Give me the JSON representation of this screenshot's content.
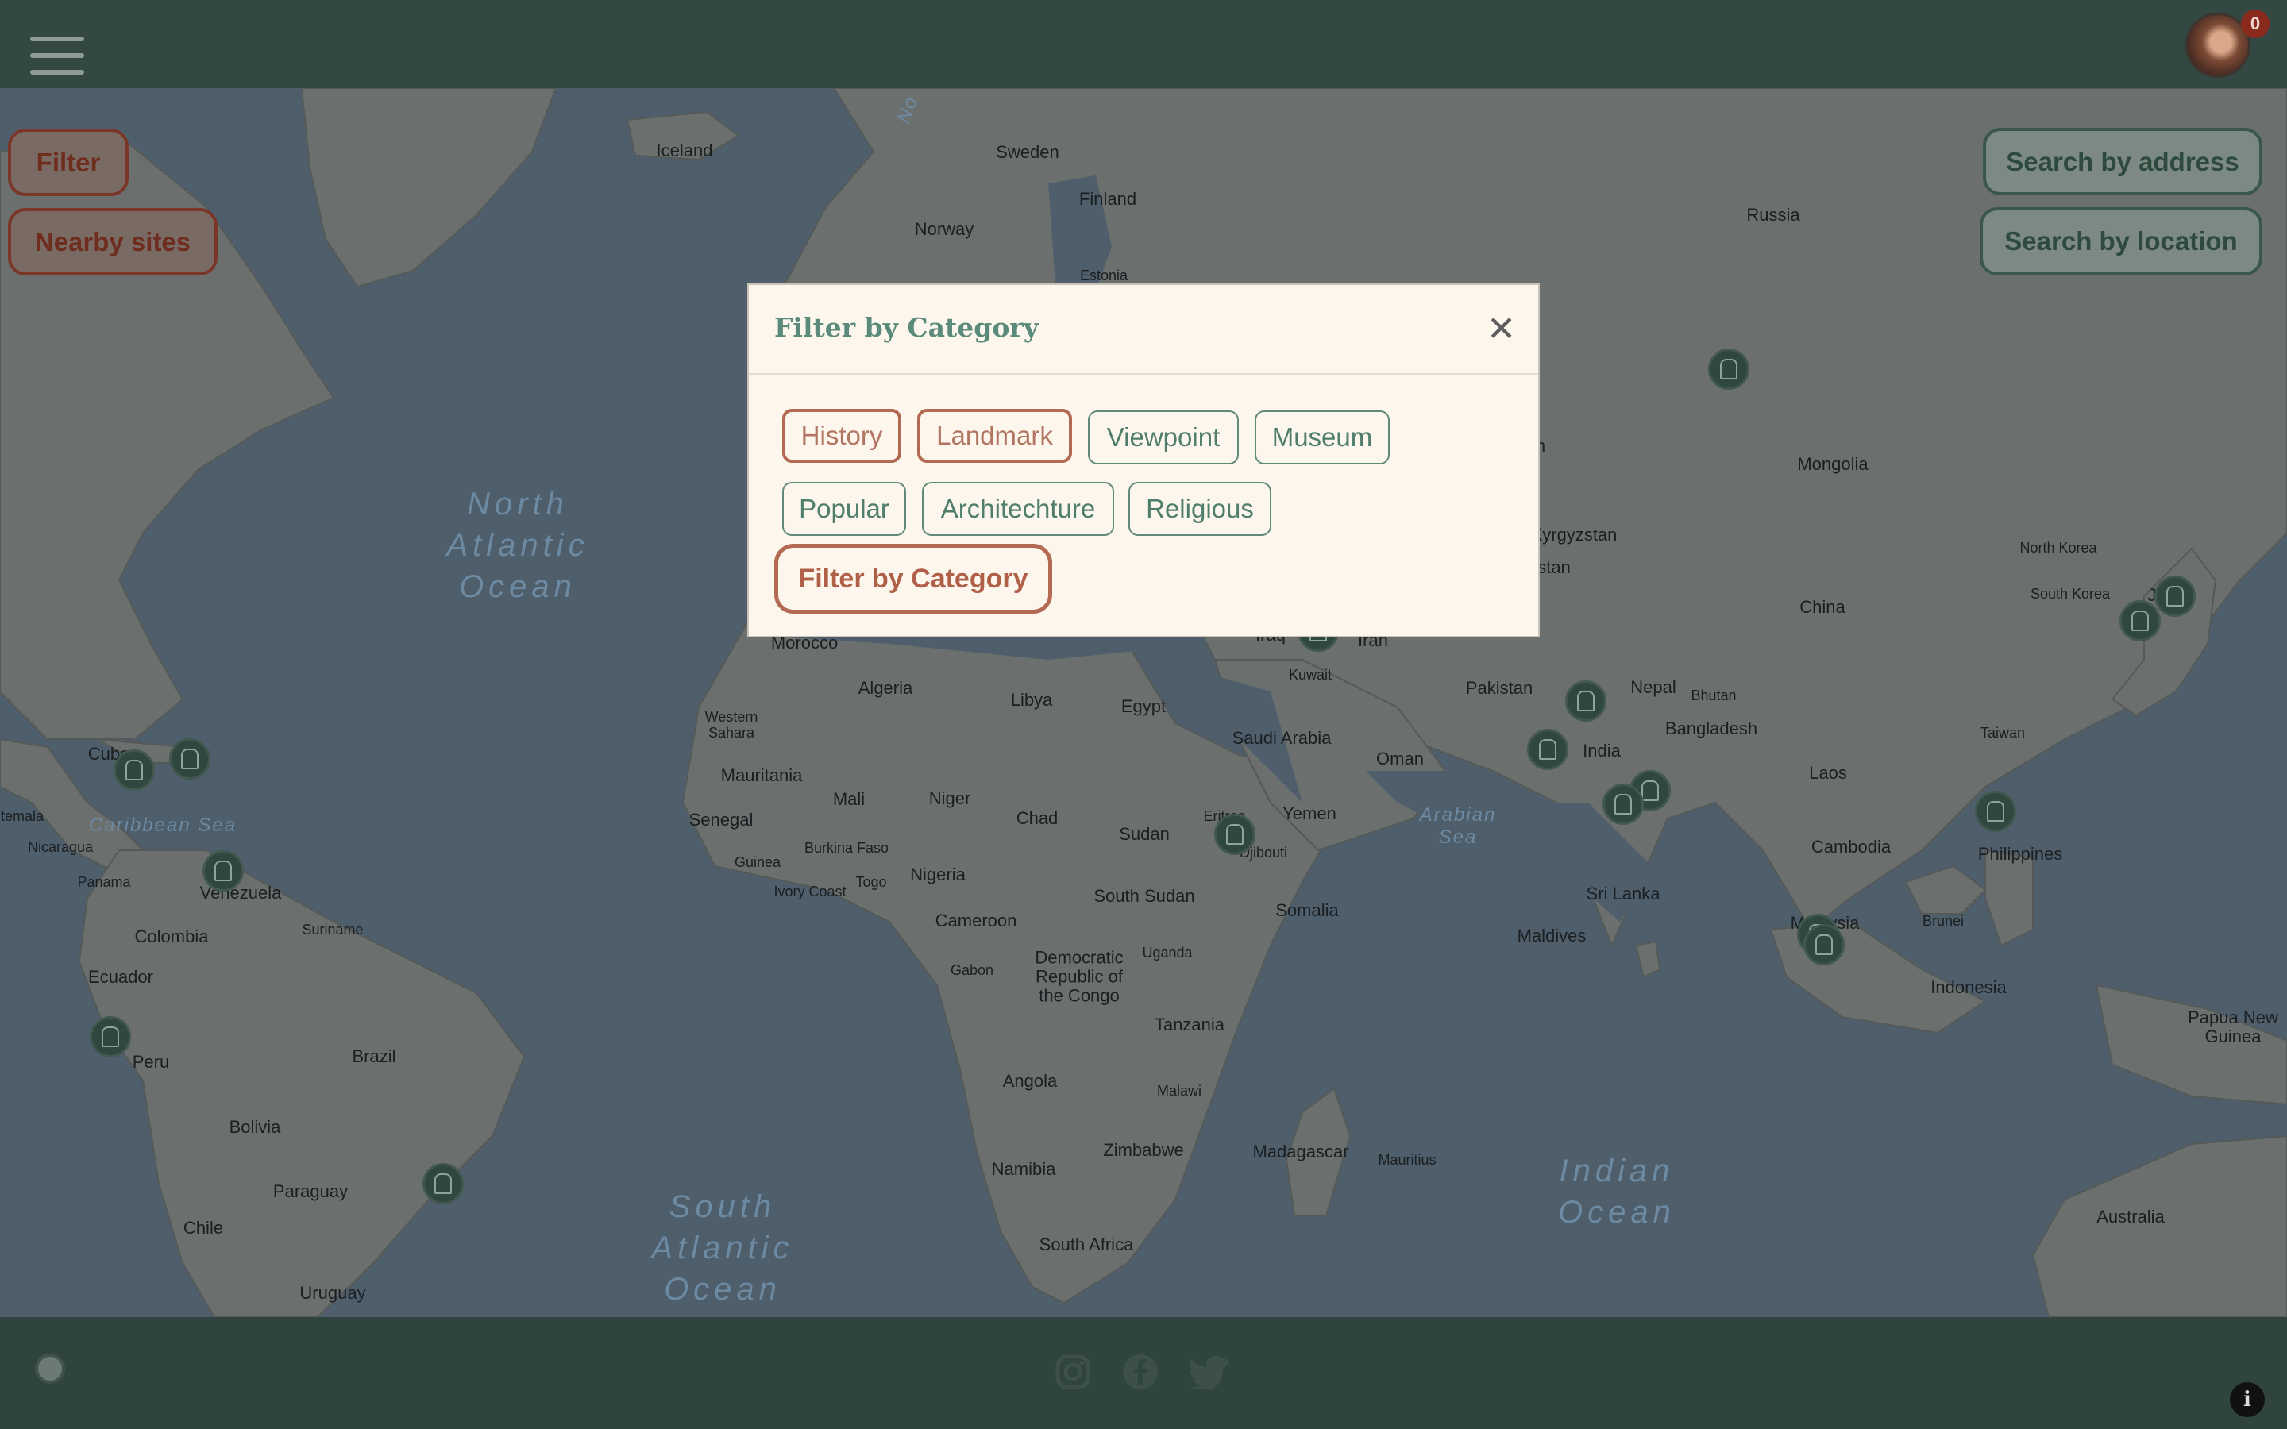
{
  "header": {
    "menu_icon": "hamburger-menu-icon",
    "avatar_icon": "user-avatar",
    "notification_count": "0"
  },
  "left_controls": {
    "filter_label": "Filter",
    "nearby_label": "Nearby sites"
  },
  "right_controls": {
    "address_label": "Search by address",
    "location_label": "Search by location"
  },
  "map": {
    "oceans": [
      {
        "id": "north-atlantic",
        "text": "North\nAtlantic\nOcean"
      },
      {
        "id": "south-atlantic",
        "text": "South\nAtlantic\nOcean"
      },
      {
        "id": "indian",
        "text": "Indian\nOcean"
      }
    ],
    "seas": [
      "Caribbean Sea",
      "Arabian\nSea",
      "No"
    ],
    "places": [
      "Iceland",
      "Sweden",
      "Finland",
      "Norway",
      "Estonia",
      "Russia",
      "Mongolia",
      "Kyrgyzstan",
      "stan",
      "n",
      "North Korea",
      "South Korea",
      "Ja",
      "China",
      "Iran",
      "Iraq",
      "Kuwait",
      "Pakistan",
      "Nepal",
      "Bhutan",
      "Bangladesh",
      "India",
      "Taiwan",
      "Laos",
      "Philippines",
      "Cambodia",
      "Sri Lanka",
      "Maldives",
      "Malaysia",
      "Brunei",
      "Indonesia",
      "Papua New\nGuinea",
      "Australia",
      "Morocco",
      "Algeria",
      "Libya",
      "Egypt",
      "Western\nSahara",
      "Saudi Arabia",
      "Oman",
      "Mauritania",
      "Mali",
      "Niger",
      "Chad",
      "Sudan",
      "Yemen",
      "Eritrea",
      "Djibouti",
      "Senegal",
      "Burkina Faso",
      "Guinea",
      "Ivory Coast",
      "Togo",
      "Nigeria",
      "South Sudan",
      "Somalia",
      "Cameroon",
      "Gabon",
      "Democratic\nRepublic of\nthe Congo",
      "Uganda",
      "Tanzania",
      "Angola",
      "Malawi",
      "Zimbabwe",
      "Namibia",
      "Madagascar",
      "Mauritius",
      "South Africa",
      "Cuba",
      "temala",
      "Nicaragua",
      "Panama",
      "Venezuela",
      "Colombia",
      "Suriname",
      "Ecuador",
      "Peru",
      "Brazil",
      "Bolivia",
      "Paraguay",
      "Chile",
      "Uruguay"
    ],
    "pin_icon": "landmark-pin-icon"
  },
  "modal": {
    "title": "Filter by Category",
    "close_icon": "close-icon",
    "categories": [
      {
        "label": "History",
        "selected": true
      },
      {
        "label": "Landmark",
        "selected": true
      },
      {
        "label": "Viewpoint",
        "selected": false
      },
      {
        "label": "Museum",
        "selected": false
      },
      {
        "label": "Popular",
        "selected": false
      },
      {
        "label": "Architechture",
        "selected": false
      },
      {
        "label": "Religious",
        "selected": false
      }
    ],
    "apply_label": "Filter by Category"
  },
  "footer": {
    "chat_icon": "chat-icon",
    "social_icons": [
      "instagram-icon",
      "facebook-icon",
      "twitter-icon"
    ],
    "info_icon": "info-icon"
  },
  "colors": {
    "header_bg": "#334843",
    "accent_red": "#b26a52",
    "accent_green": "#5f8a78",
    "modal_bg": "#fdf6ec"
  }
}
